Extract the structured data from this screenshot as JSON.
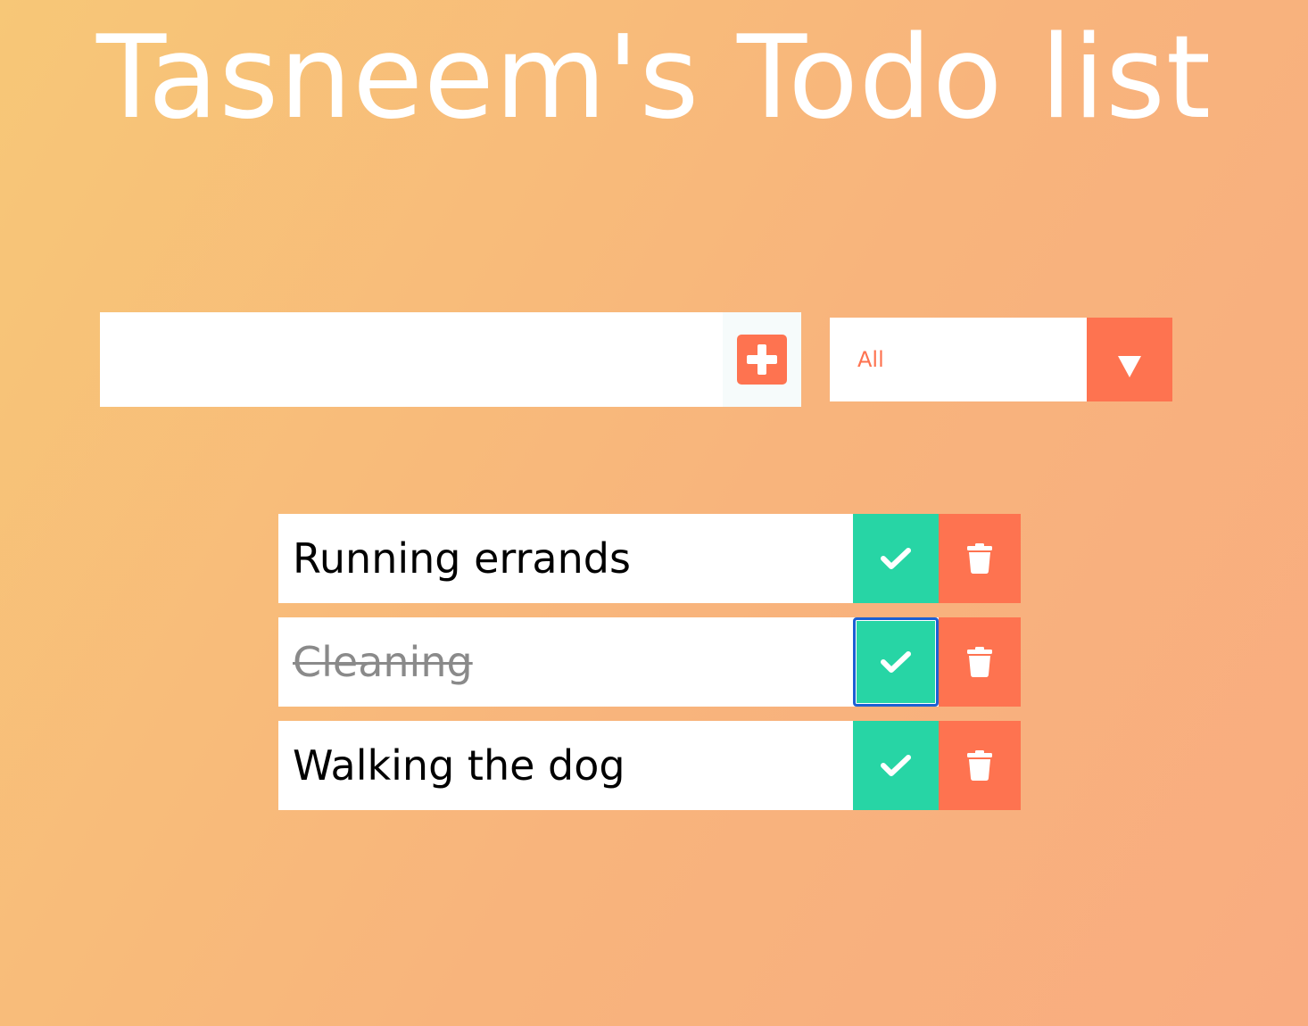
{
  "header": {
    "title": "Tasneem's Todo list"
  },
  "add_form": {
    "input_value": "",
    "add_icon": "plus-square-icon"
  },
  "filter": {
    "selected": "All",
    "arrow_icon": "caret-down-icon"
  },
  "todos": [
    {
      "text": "Running errands",
      "completed": false
    },
    {
      "text": "Cleaning",
      "completed": true
    },
    {
      "text": "Walking the dog",
      "completed": false
    }
  ],
  "icons": {
    "complete": "check-icon",
    "delete": "trash-icon"
  },
  "colors": {
    "accent": "#fe7350",
    "complete": "#27d5a5",
    "background_start": "#f7c777",
    "background_end": "#f9ac80"
  }
}
